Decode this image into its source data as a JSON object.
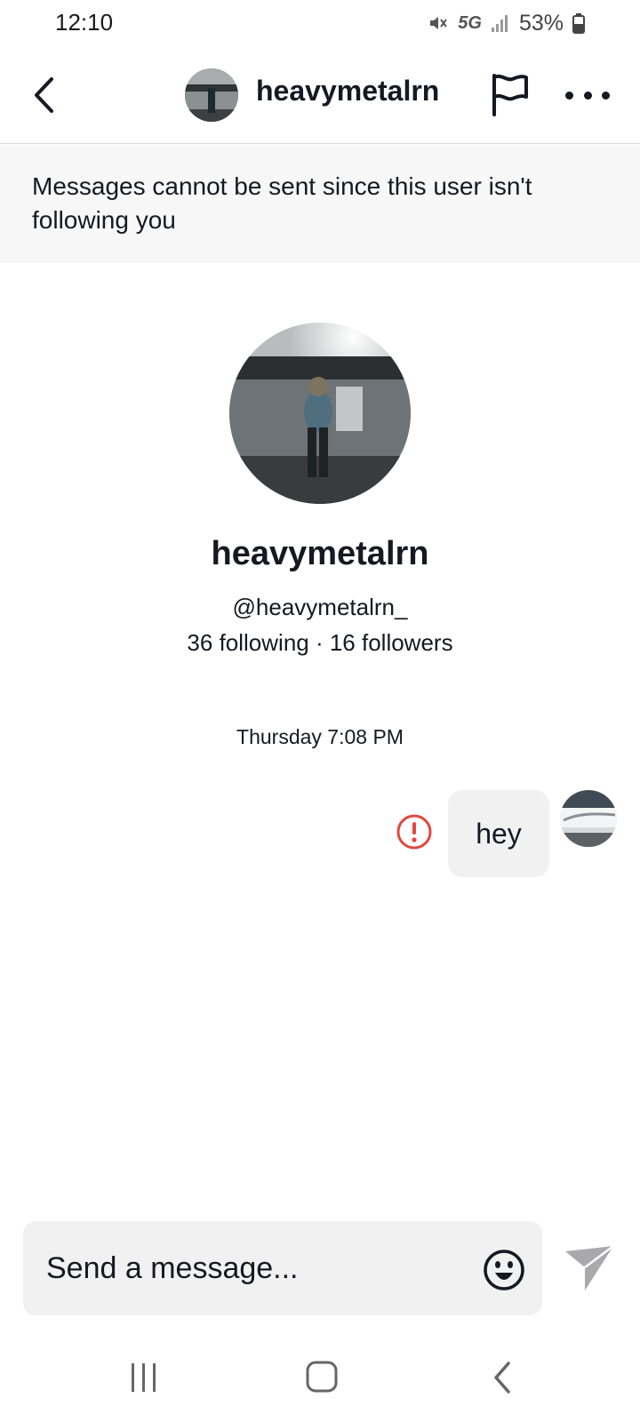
{
  "status_bar": {
    "time": "12:10",
    "network": "5G",
    "battery": "53%",
    "icons": [
      "mute-icon",
      "signal-icon",
      "battery-icon"
    ]
  },
  "header": {
    "username": "heavymetalrn",
    "icons": [
      "back-arrow-icon",
      "flag-icon",
      "more-dots-icon"
    ]
  },
  "notice": {
    "text": "Messages cannot be sent since this user isn't following you"
  },
  "profile": {
    "display_name": "heavymetalrn",
    "handle": "@heavymetalrn_",
    "stats": "36 following · 16 followers"
  },
  "conversation": {
    "timestamp": "Thursday 7:08 PM",
    "messages": [
      {
        "text": "hey",
        "status": "failed",
        "from": "self"
      }
    ]
  },
  "composer": {
    "placeholder": "Send a message...",
    "icons": [
      "emoji-icon",
      "send-icon"
    ]
  },
  "nav": {
    "icons": [
      "recent-apps-icon",
      "home-icon",
      "back-icon"
    ]
  },
  "colors": {
    "error": "#e0483e",
    "bubble": "#f1f1f2",
    "banner": "#f7f7f7",
    "send_disabled": "#a8a8ad"
  }
}
